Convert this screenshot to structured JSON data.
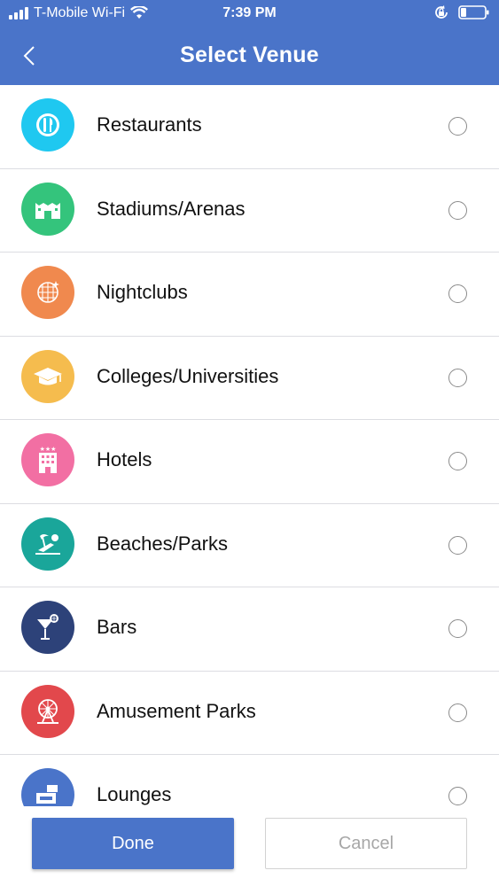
{
  "status_bar": {
    "carrier": "T-Mobile Wi-Fi",
    "time": "7:39 PM"
  },
  "nav": {
    "title": "Select Venue"
  },
  "venues": [
    {
      "label": "Restaurants",
      "icon": "fork-knife-icon",
      "color": "#1fc8f0",
      "selected": false
    },
    {
      "label": "Stadiums/Arenas",
      "icon": "stadium-icon",
      "color": "#34c47c",
      "selected": false
    },
    {
      "label": "Nightclubs",
      "icon": "disco-ball-icon",
      "color": "#f0894e",
      "selected": false
    },
    {
      "label": "Colleges/Universities",
      "icon": "graduation-cap-icon",
      "color": "#f5bc4e",
      "selected": false
    },
    {
      "label": "Hotels",
      "icon": "hotel-icon",
      "color": "#f26fa3",
      "selected": false
    },
    {
      "label": "Beaches/Parks",
      "icon": "beach-chair-icon",
      "color": "#1aa69a",
      "selected": false
    },
    {
      "label": "Bars",
      "icon": "cocktail-icon",
      "color": "#2d4279",
      "selected": false
    },
    {
      "label": "Amusement Parks",
      "icon": "ferris-wheel-icon",
      "color": "#e2484c",
      "selected": false
    },
    {
      "label": "Lounges",
      "icon": "lounge-icon",
      "color": "#4a74c9",
      "selected": false
    }
  ],
  "footer": {
    "done_label": "Done",
    "cancel_label": "Cancel"
  },
  "colors": {
    "accent": "#4a74c9"
  }
}
